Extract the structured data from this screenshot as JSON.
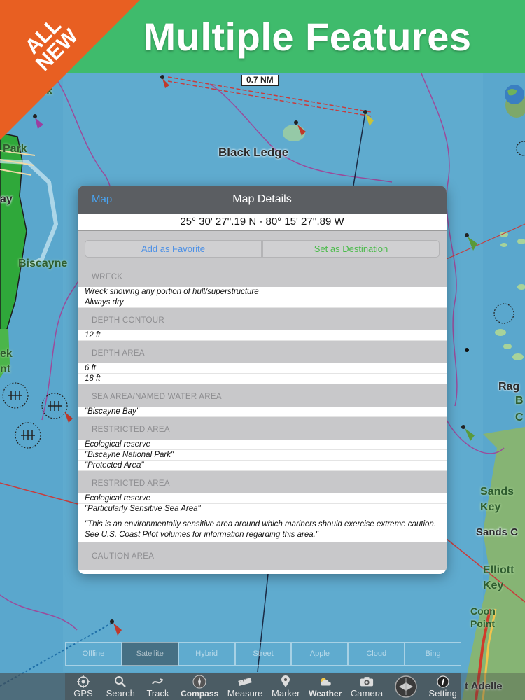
{
  "banner": {
    "title": "Multiple Features",
    "corner_badge": "ALL NEW",
    "colors": {
      "banner": "#3fbb6c",
      "corner": "#e85f22"
    }
  },
  "map": {
    "scale_label": "0.7 NM",
    "labels": {
      "black_ledge": "Black Ledge",
      "park": "Park",
      "ay": "ay",
      "biscayne": "Biscayne",
      "rk": "rk",
      "ek": "ek",
      "nt": "nt",
      "rag": "Rag",
      "b": "B",
      "c": "C",
      "sands_key": "Sands Key",
      "sands": "Sands C",
      "elliott_key": "Elliott Key",
      "coon_point": "Coon Point",
      "adelle": "t Adelle"
    }
  },
  "popover": {
    "back_label": "Map",
    "title": "Map Details",
    "coordinates": "25° 30' 27''.19 N  -  80° 15' 27''.89 W",
    "add_favorite": "Add as Favorite",
    "set_destination": "Set as Destination",
    "sections": [
      {
        "header": "WRECK",
        "rows": [
          "Wreck showing any portion of hull/superstructure",
          "Always dry"
        ]
      },
      {
        "header": "DEPTH CONTOUR",
        "rows": [
          "12 ft"
        ]
      },
      {
        "header": "DEPTH AREA",
        "rows": [
          "6 ft",
          "18 ft"
        ]
      },
      {
        "header": "SEA AREA/NAMED WATER AREA",
        "rows": [
          "\"Biscayne Bay\""
        ]
      },
      {
        "header": "RESTRICTED AREA",
        "rows": [
          "Ecological reserve",
          "\"Biscayne National Park\"",
          "\"Protected Area\""
        ]
      },
      {
        "header": "RESTRICTED AREA",
        "rows": [
          "Ecological reserve",
          "\"Particularly Sensitive Sea Area\""
        ],
        "note": "\"This is an environmentally sensitive area around which mariners should exercise extreme caution. See U.S. Coast Pilot volumes for information regarding this area.\""
      },
      {
        "header": "CAUTION AREA",
        "rows": []
      }
    ]
  },
  "map_type_segments": [
    "Offline",
    "Satellite",
    "Hybrid",
    "Street",
    "Apple",
    "Cloud",
    "Bing"
  ],
  "toolbar": {
    "items": [
      {
        "label": "GPS",
        "icon": "gps-icon"
      },
      {
        "label": "Search",
        "icon": "search-icon"
      },
      {
        "label": "Track",
        "icon": "track-icon"
      },
      {
        "label": "Compass",
        "icon": "compass-icon"
      },
      {
        "label": "Measure",
        "icon": "ruler-icon"
      },
      {
        "label": "Marker",
        "icon": "marker-icon"
      },
      {
        "label": "Weather",
        "icon": "weather-icon"
      },
      {
        "label": "Camera",
        "icon": "camera-icon"
      },
      {
        "label": "",
        "icon": "app-logo-icon"
      },
      {
        "label": "Setting",
        "icon": "settings-icon"
      }
    ]
  }
}
